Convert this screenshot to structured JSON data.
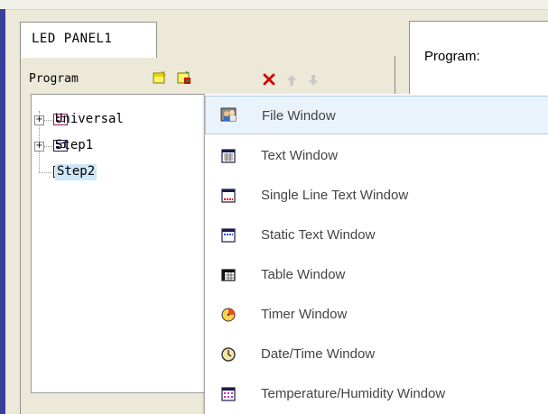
{
  "tab": {
    "label": "LED PANEL1"
  },
  "toolbar": {
    "program_label": "Program",
    "icons": [
      "new-program-icon",
      "add-program-icon",
      "delete-icon",
      "move-up-icon",
      "move-down-icon"
    ]
  },
  "program_box": {
    "label": "Program:"
  },
  "tree": {
    "items": [
      {
        "label": "Universal",
        "icon": "program-node-icon",
        "expandable": true,
        "selected": false
      },
      {
        "label": "Step1",
        "icon": "program-node-icon",
        "expandable": true,
        "selected": false
      },
      {
        "label": "Step2",
        "icon": "program-node-icon",
        "expandable": false,
        "selected": true
      }
    ]
  },
  "menu": {
    "items": [
      {
        "label": "File Window",
        "icon": "file-window-icon",
        "hover": true
      },
      {
        "label": "Text Window",
        "icon": "text-window-icon"
      },
      {
        "label": "Single Line Text Window",
        "icon": "single-line-text-window-icon"
      },
      {
        "label": "Static Text Window",
        "icon": "static-text-window-icon"
      },
      {
        "label": "Table Window",
        "icon": "table-window-icon"
      },
      {
        "label": "Timer Window",
        "icon": "timer-window-icon"
      },
      {
        "label": "Date/Time Window",
        "icon": "date-time-window-icon"
      },
      {
        "label": "Temperature/Humidity Window",
        "icon": "temperature-humidity-window-icon"
      }
    ]
  },
  "colors": {
    "delete": "#d40000",
    "accent_bar": "#3b3f9b",
    "selection": "#cde7f7",
    "hover": "#eaf3fb"
  }
}
